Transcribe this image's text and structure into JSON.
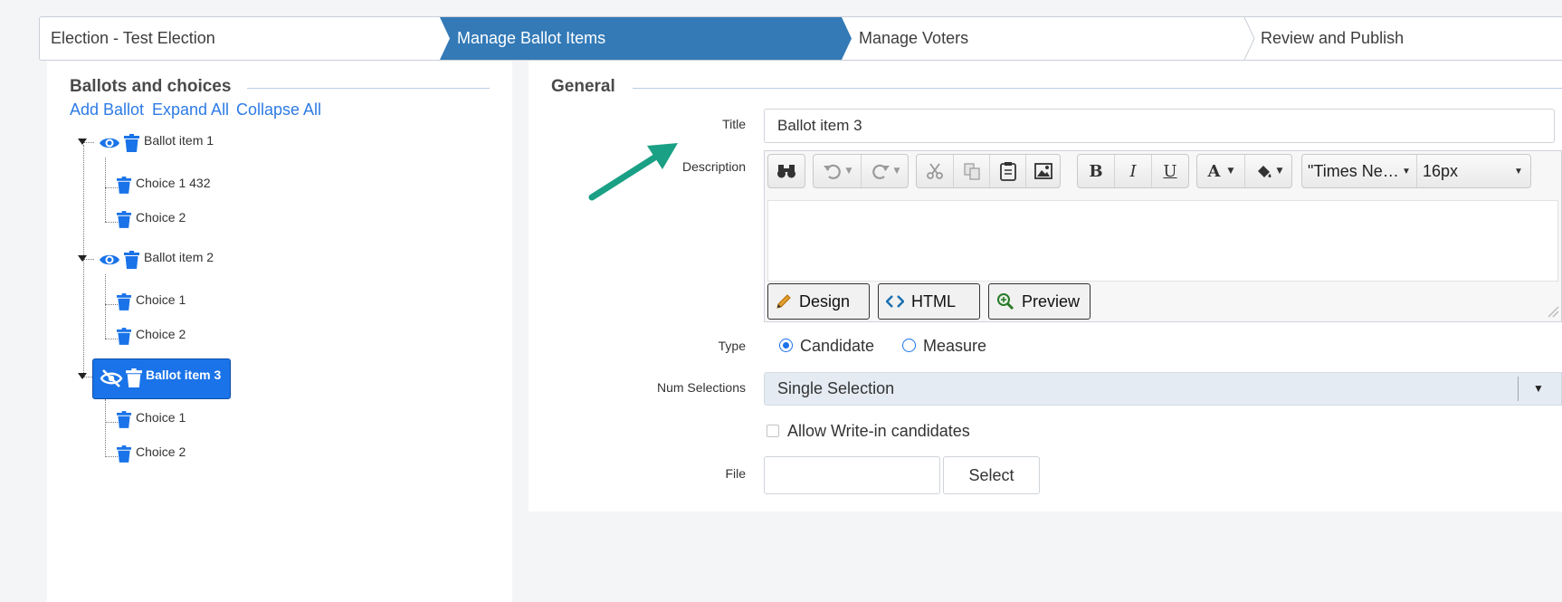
{
  "wizard": {
    "steps": [
      {
        "label": "Election - Test Election",
        "active": false
      },
      {
        "label": "Manage Ballot Items",
        "active": true
      },
      {
        "label": "Manage Voters",
        "active": false
      },
      {
        "label": "Review and Publish",
        "active": false
      }
    ],
    "active_color": "#337ab7"
  },
  "left_panel": {
    "title": "Ballots and choices",
    "links": {
      "add_ballot": "Add Ballot",
      "expand_all": "Expand All",
      "collapse_all": "Collapse All"
    },
    "tree": [
      {
        "label": "Ballot item 1",
        "visible": true,
        "selected": false,
        "choices": [
          {
            "label": "Choice 1 432"
          },
          {
            "label": "Choice 2"
          }
        ]
      },
      {
        "label": "Ballot item 2",
        "visible": true,
        "selected": false,
        "choices": [
          {
            "label": "Choice 1"
          },
          {
            "label": "Choice 2"
          }
        ]
      },
      {
        "label": "Ballot item 3",
        "visible": false,
        "selected": true,
        "choices": [
          {
            "label": "Choice 1"
          },
          {
            "label": "Choice 2"
          }
        ]
      }
    ],
    "icons": {
      "visible": "eye-icon",
      "hidden": "eye-slash-icon",
      "delete": "trash-icon"
    },
    "icon_color": "#1a73e8"
  },
  "general": {
    "title": "General",
    "fields": {
      "title_label": "Title",
      "title_value": "Ballot item 3",
      "description_label": "Description",
      "type_label": "Type",
      "type_options": [
        "Candidate",
        "Measure"
      ],
      "type_selected": "Candidate",
      "num_selections_label": "Num Selections",
      "num_selections_value": "Single Selection",
      "write_in_label": "Allow Write-in candidates",
      "write_in_checked": false,
      "file_label": "File",
      "file_value": "",
      "select_button": "Select"
    },
    "editor": {
      "toolbar": {
        "find": "binoculars-icon",
        "undo": "undo-icon",
        "redo": "redo-icon",
        "cut": "scissors-icon",
        "copy": "copy-icon",
        "paste": "clipboard-icon",
        "image": "image-icon",
        "bold": "B",
        "italic": "I",
        "underline": "U",
        "font_color": "A",
        "back_color": "fill-icon",
        "font_name": "\"Times Ne…",
        "font_size": "16px"
      },
      "modes": [
        "Design",
        "HTML",
        "Preview"
      ],
      "mode_icons": [
        "pencil-icon",
        "code-icon",
        "zoom-icon"
      ]
    }
  },
  "annotation": {
    "arrow": "arrow-icon",
    "color": "#1aa085"
  }
}
